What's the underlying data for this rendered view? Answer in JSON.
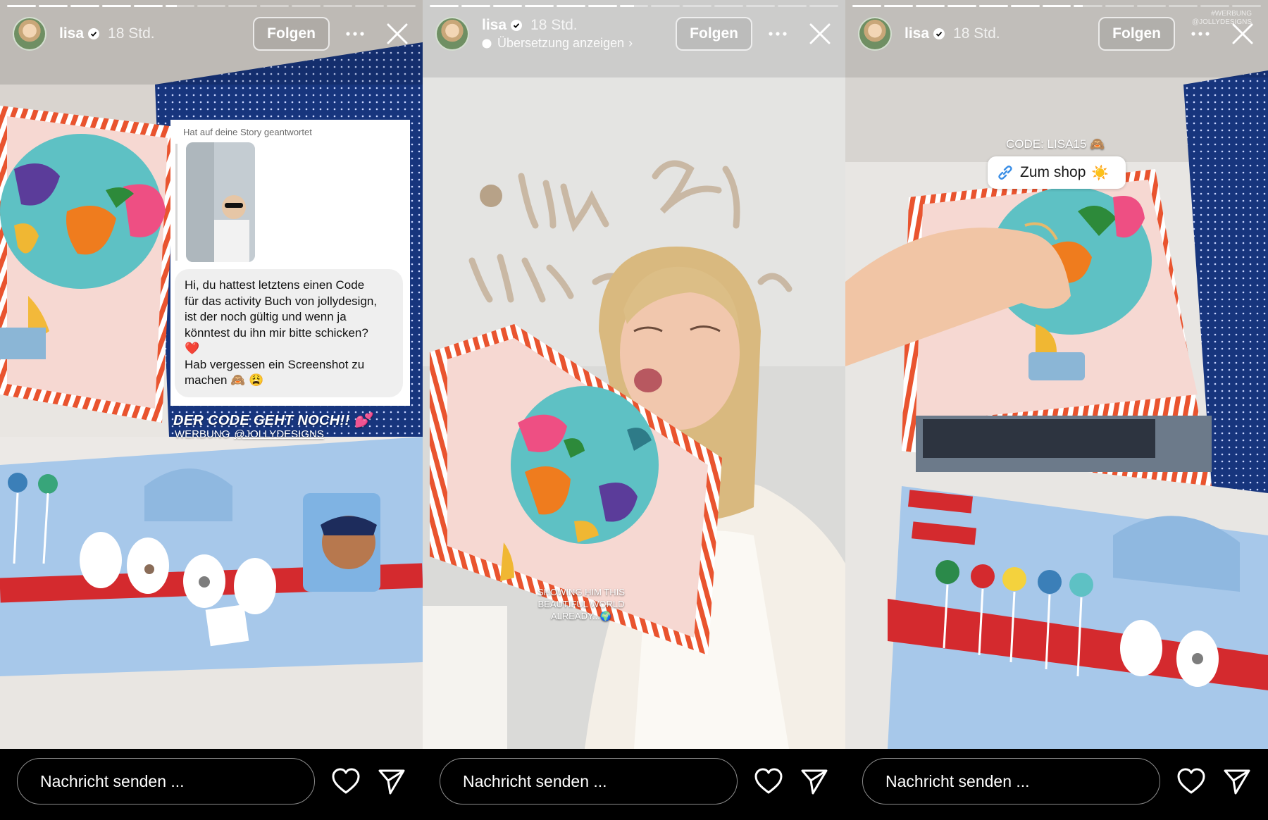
{
  "colors": {
    "background": "#000000",
    "text": "#ffffff",
    "felt_blue": "#9fc3e6",
    "felt_teal": "#5ec1c4",
    "felt_red": "#e0262c",
    "page_pink": "#f7ddd7",
    "stripe_red": "#e9542f"
  },
  "stories": [
    {
      "username": "lisa",
      "time": "18 Std.",
      "subtitle": "",
      "follow_label": "Folgen",
      "progress": [
        1,
        1,
        1,
        1,
        1,
        0.4,
        0,
        0,
        0,
        0,
        0,
        0,
        0
      ],
      "reply": {
        "label": "Hat auf deine Story geantwortet",
        "message_lines": [
          "Hi, du hattest letztens einen Code",
          "für das activity Buch von jollydesign,",
          "ist der noch gültig und wenn ja",
          "könntest du ihn mir bitte schicken?",
          "❤️",
          "Hab vergessen ein Screenshot zu",
          "machen 🙈 😩"
        ]
      },
      "caption": "DER CODE GEHT NOCH!! 💕",
      "ad_label": "WERBUNG",
      "ad_mention": "@JOLLYDESIGNS",
      "message_placeholder": "Nachricht senden ..."
    },
    {
      "username": "lisa",
      "time": "18 Std.",
      "subtitle": "Übersetzung anzeigen",
      "follow_label": "Folgen",
      "progress": [
        1,
        1,
        1,
        1,
        1,
        1,
        0.5,
        0,
        0,
        0,
        0,
        0,
        0
      ],
      "wall_text_top": "stay wild",
      "wall_text_bottom": "child...",
      "caption_lines": [
        "SHOWING HIM THIS",
        "BEAUTIFUL WORLD",
        "ALREADY...🌍"
      ],
      "message_placeholder": "Nachricht senden ..."
    },
    {
      "username": "lisa",
      "time": "18 Std.",
      "subtitle": "",
      "follow_label": "Folgen",
      "progress": [
        1,
        1,
        1,
        1,
        1,
        1,
        1,
        0.3,
        0,
        0,
        0,
        0,
        0
      ],
      "code_text": "CODE: LISA15 🙈",
      "link_label": "Zum shop",
      "link_emoji": "☀️",
      "watermark_lines": [
        "#WERBUNG",
        "@JOLLYDESIGNS"
      ],
      "message_placeholder": "Nachricht senden ..."
    }
  ],
  "icons": {
    "verified": "verified-badge-icon",
    "more": "more-dots-icon",
    "close": "close-icon",
    "heart": "heart-icon",
    "send": "send-icon",
    "translate": "speech-bubble-icon",
    "link": "link-icon"
  }
}
